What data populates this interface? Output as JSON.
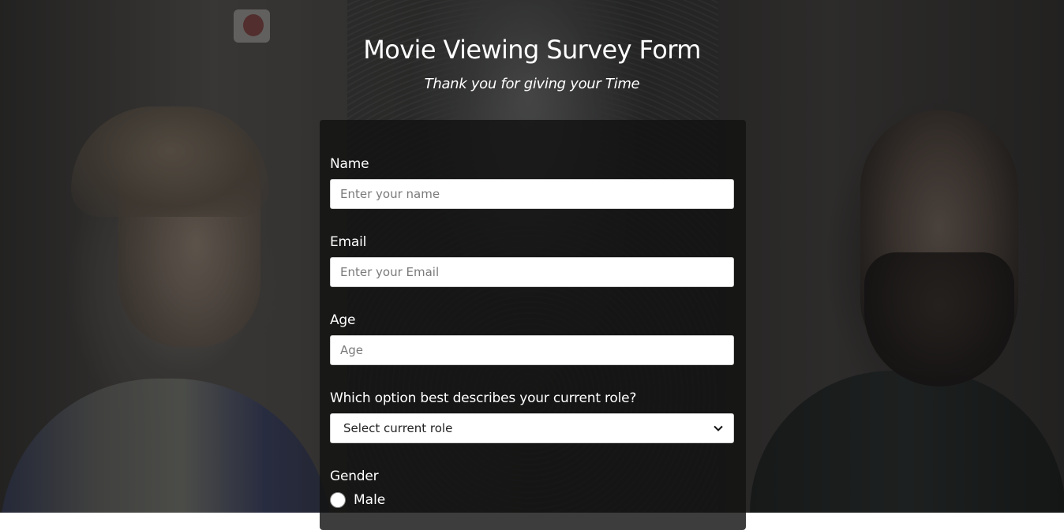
{
  "header": {
    "title": "Movie Viewing Survey Form",
    "subtitle": "Thank you for giving your Time"
  },
  "form": {
    "name": {
      "label": "Name",
      "placeholder": "Enter your name",
      "value": ""
    },
    "email": {
      "label": "Email",
      "placeholder": "Enter your Email",
      "value": ""
    },
    "age": {
      "label": "Age",
      "placeholder": "Age",
      "value": ""
    },
    "role": {
      "label": "Which option best describes your current role?",
      "selected": "Select current role"
    },
    "gender": {
      "label": "Gender",
      "options": [
        "Male"
      ]
    }
  },
  "icons": {
    "select_chevron": "chevron-down-icon",
    "radio": "radio-unchecked-icon"
  },
  "colors": {
    "card_background": "#121212",
    "text": "#ffffff",
    "input_background": "#ffffff"
  }
}
